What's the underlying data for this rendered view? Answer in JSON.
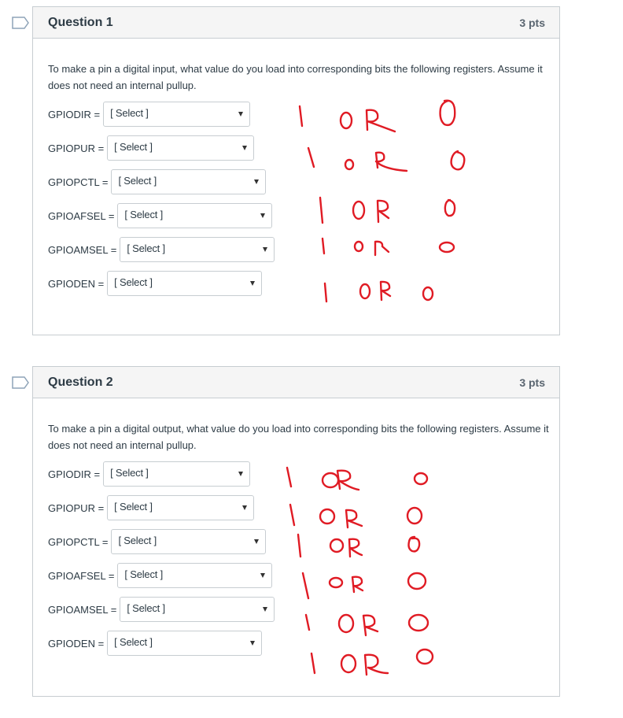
{
  "questions": [
    {
      "title": "Question 1",
      "points": "3 pts",
      "prompt": "To make a pin a digital input, what value do you load into corresponding bits the following registers. Assume it does not need an internal pullup.",
      "fields": [
        {
          "label": "GPIODIR =",
          "value": "[ Select ]"
        },
        {
          "label": "GPIOPUR =",
          "value": "[ Select ]"
        },
        {
          "label": "GPIOPCTL =",
          "value": "[ Select ]"
        },
        {
          "label": "GPIOAFSEL =",
          "value": "[ Select ]"
        },
        {
          "label": "GPIOAMSEL =",
          "value": "[ Select ]"
        },
        {
          "label": "GPIODEN =",
          "value": "[ Select ]"
        }
      ],
      "annotations": [
        "1 OR 0",
        "1 OR 0",
        "1 OR 0",
        "1 OR 0",
        "1 OR 0",
        "1 OR 0"
      ]
    },
    {
      "title": "Question 2",
      "points": "3 pts",
      "prompt": "To make a pin a digital output, what value do you load into corresponding bits the following registers. Assume it does not need an internal pullup.",
      "fields": [
        {
          "label": "GPIODIR =",
          "value": "[ Select ]"
        },
        {
          "label": "GPIOPUR =",
          "value": "[ Select ]"
        },
        {
          "label": "GPIOPCTL =",
          "value": "[ Select ]"
        },
        {
          "label": "GPIOAFSEL =",
          "value": "[ Select ]"
        },
        {
          "label": "GPIOAMSEL =",
          "value": "[ Select ]"
        },
        {
          "label": "GPIODEN =",
          "value": "[ Select ]"
        }
      ],
      "annotations": [
        "1 OR 0",
        "1 OR 0",
        "1 OR 0",
        "1 OR 0",
        "1 OR 0",
        "1 OR 0"
      ]
    }
  ],
  "icons": {
    "bookmark": "bookmark-outline-icon",
    "dropdown": "caret-down-icon"
  },
  "colors": {
    "annotation": "#e01b24",
    "header_bg": "#f5f5f5",
    "border": "#c7cdd1",
    "bookmark": "#8ea3b8"
  }
}
